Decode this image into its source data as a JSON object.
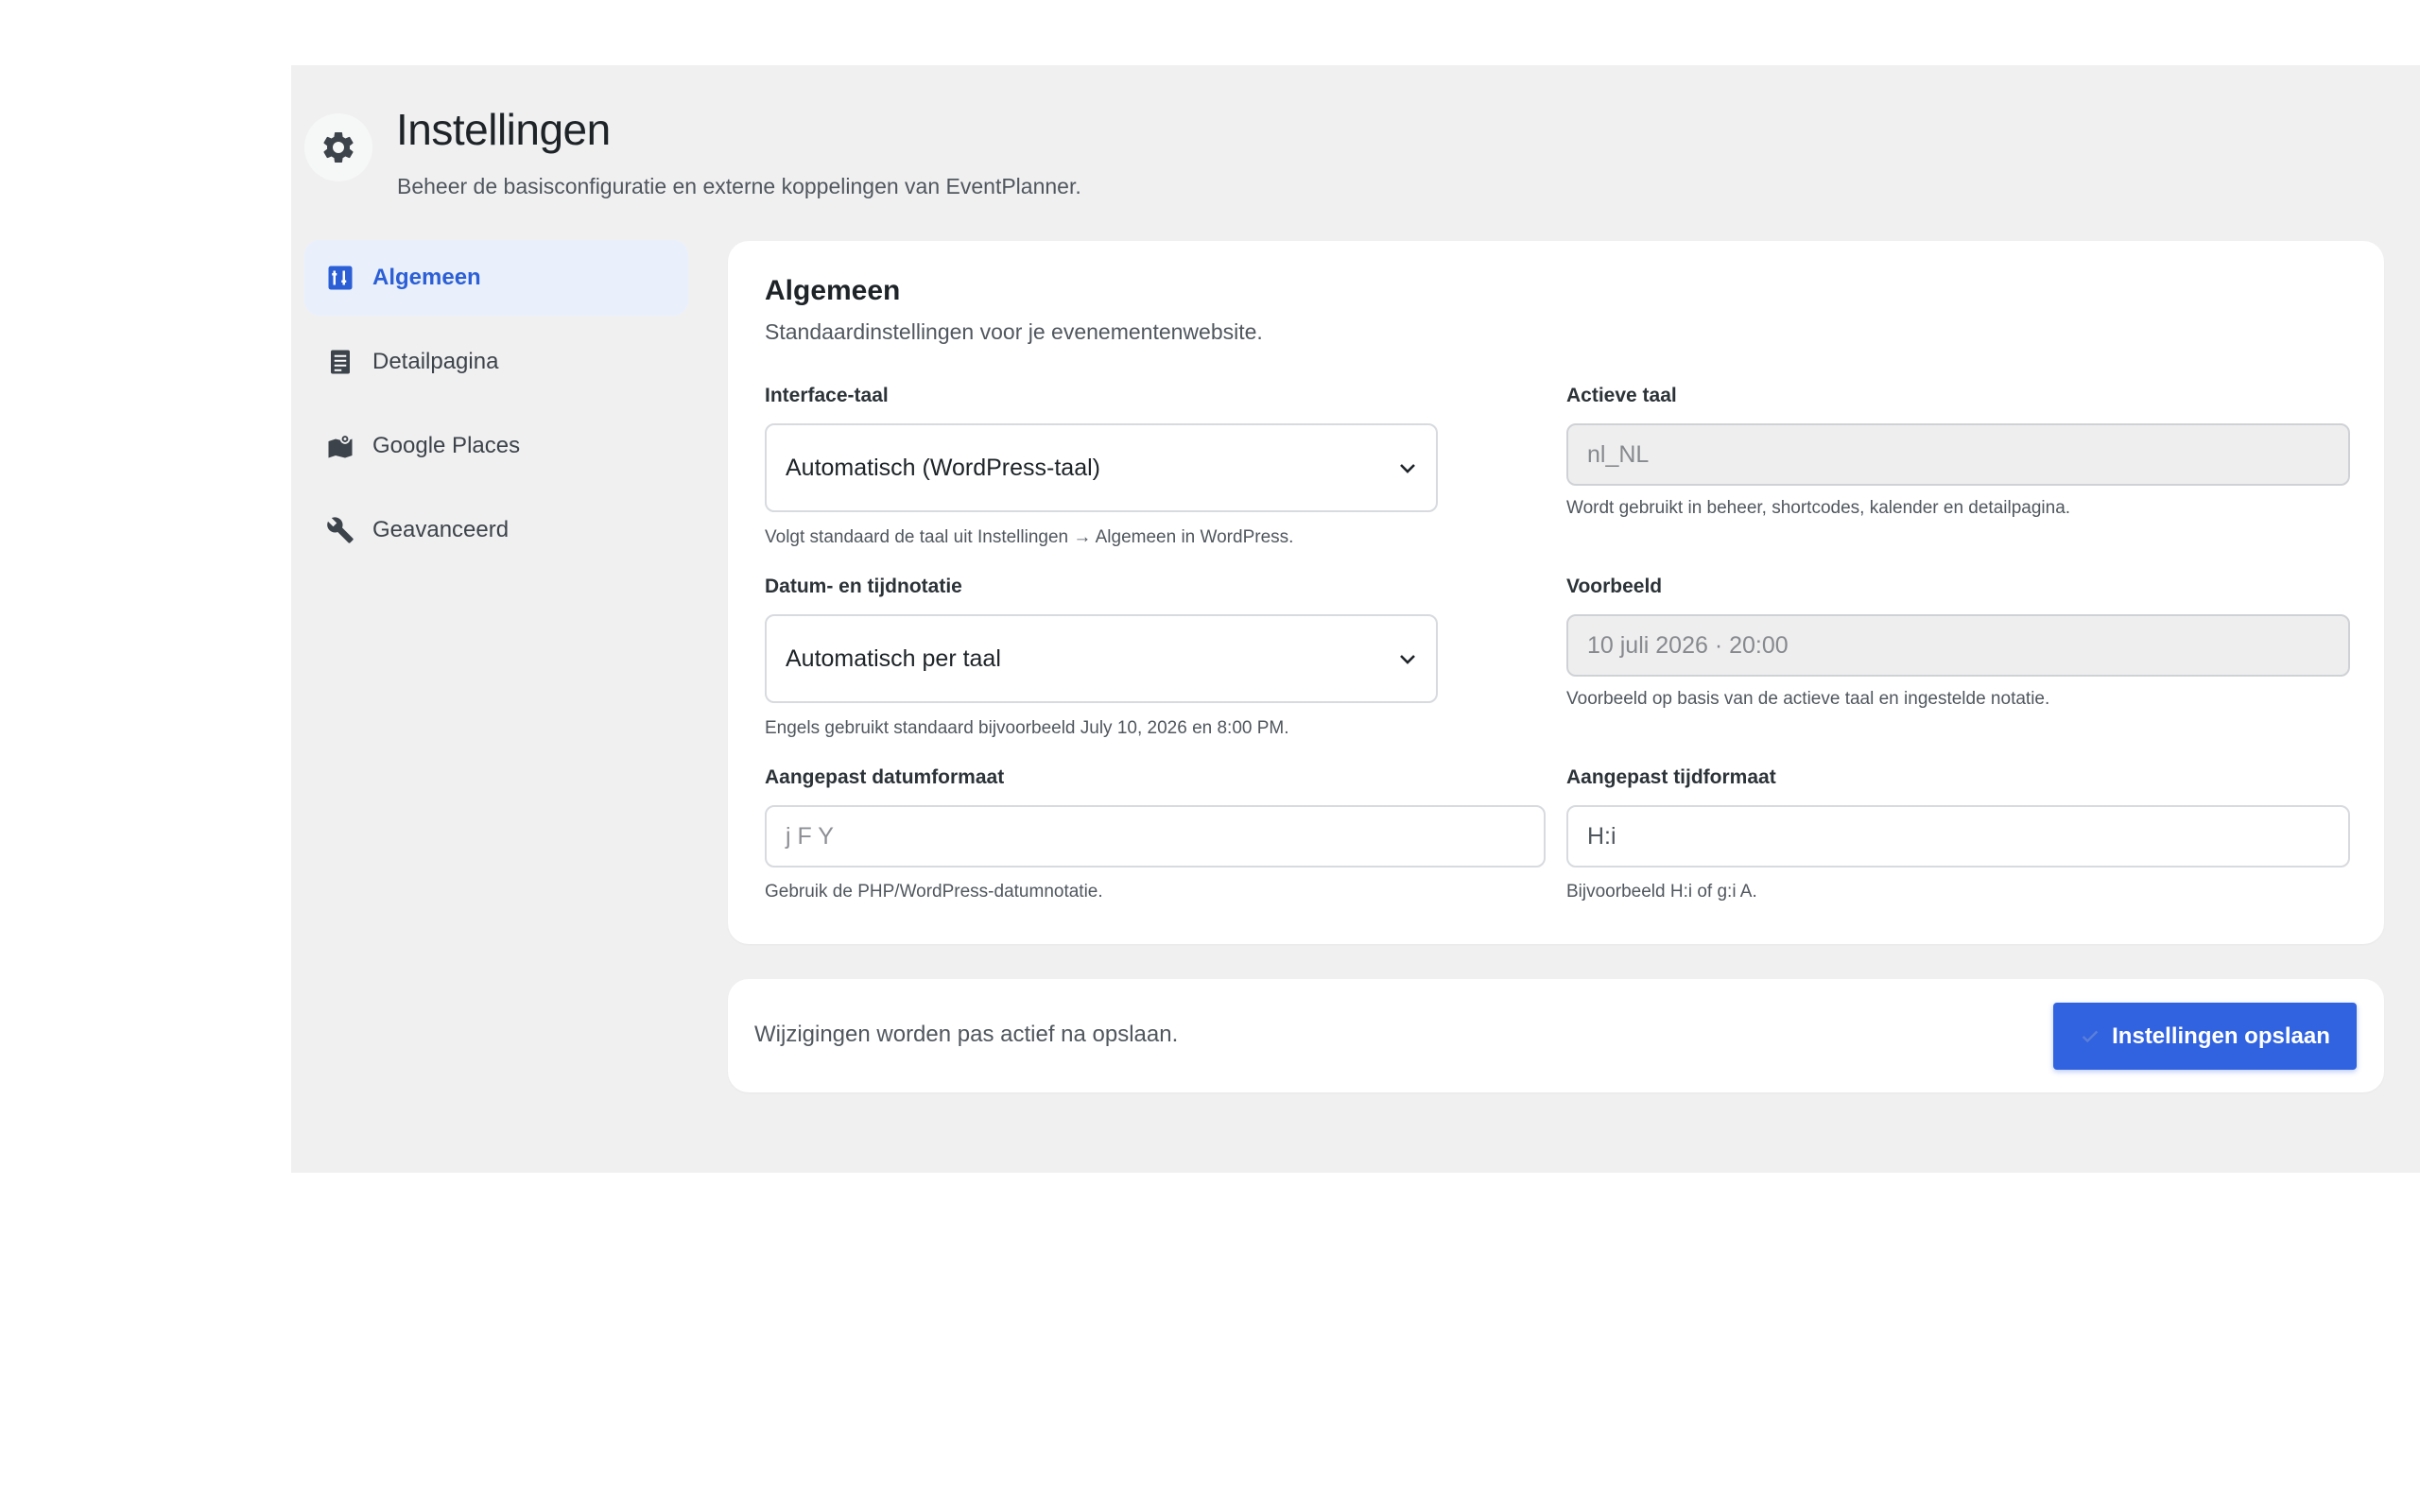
{
  "header": {
    "title": "Instellingen",
    "subtitle": "Beheer de basisconfiguratie en externe koppelingen van EventPlanner.",
    "icon": "gear-icon"
  },
  "sidebar": {
    "items": [
      {
        "label": "Algemeen",
        "icon": "sliders-icon",
        "active": true
      },
      {
        "label": "Detailpagina",
        "icon": "document-icon",
        "active": false
      },
      {
        "label": "Google Places",
        "icon": "map-pin-icon",
        "active": false
      },
      {
        "label": "Geavanceerd",
        "icon": "wrench-icon",
        "active": false
      }
    ]
  },
  "card": {
    "title": "Algemeen",
    "subtitle": "Standaardinstellingen voor je evenementenwebsite.",
    "interface_language": {
      "label": "Interface-taal",
      "value": "Automatisch (WordPress-taal)",
      "help": "Volgt standaard de taal uit Instellingen → Algemeen in WordPress."
    },
    "active_language": {
      "label": "Actieve taal",
      "value": "nl_NL",
      "help": "Wordt gebruikt in beheer, shortcodes, kalender en detailpagina."
    },
    "date_time_notation": {
      "label": "Datum- en tijdnotatie",
      "value": "Automatisch per taal",
      "help": "Engels gebruikt standaard bijvoorbeeld July 10, 2026 en 8:00 PM."
    },
    "preview": {
      "label": "Voorbeeld",
      "value": "10 juli 2026 · 20:00",
      "help": "Voorbeeld op basis van de actieve taal en ingestelde notatie."
    },
    "custom_date_format": {
      "label": "Aangepast datumformaat",
      "placeholder": "j F Y",
      "help": "Gebruik de PHP/WordPress-datumnotatie."
    },
    "custom_time_format": {
      "label": "Aangepast tijdformaat",
      "value": "H:i",
      "help": "Bijvoorbeeld H:i of g:i A."
    }
  },
  "footer": {
    "note": "Wijzigingen worden pas actief na opslaan.",
    "save_label": "Instellingen opslaan"
  },
  "colors": {
    "accent": "#3162e0",
    "active_nav_bg": "#e9f0fc",
    "admin_bg": "#f0f0f1"
  }
}
